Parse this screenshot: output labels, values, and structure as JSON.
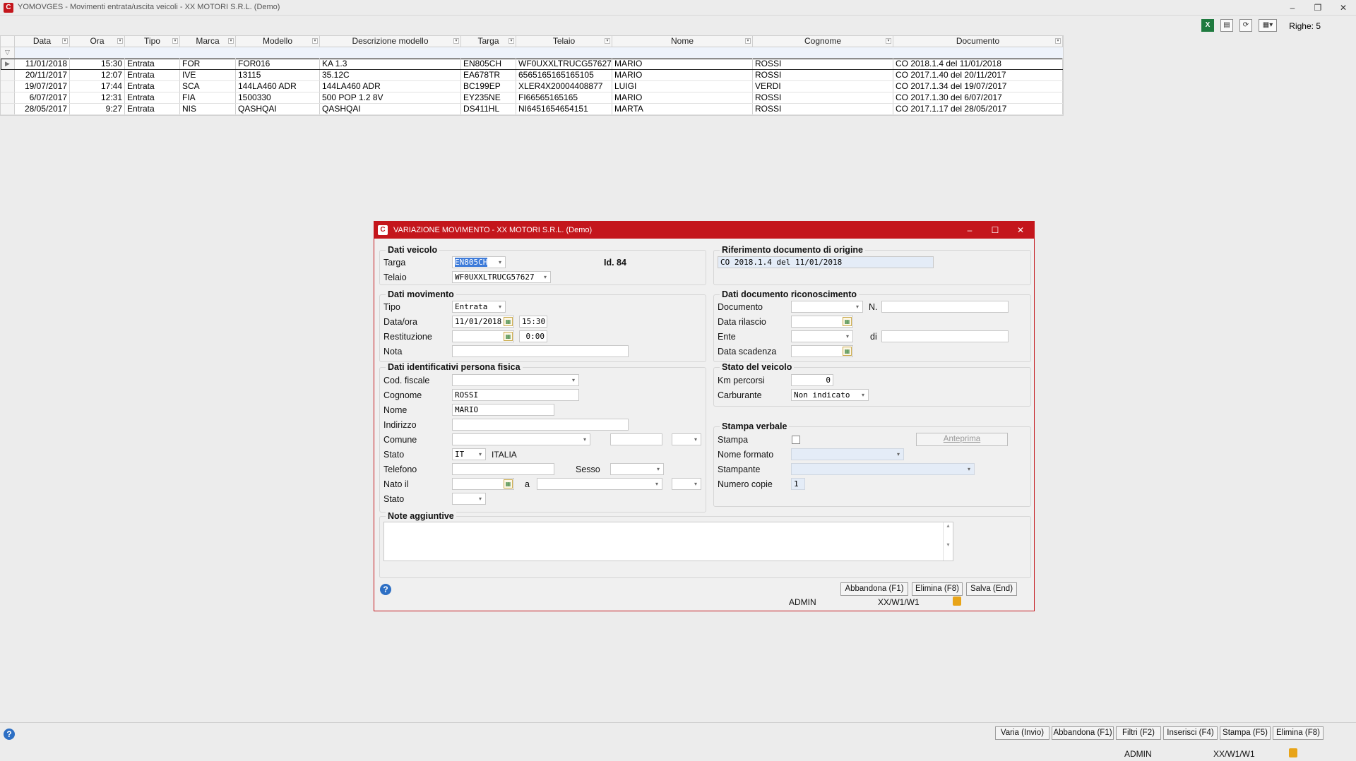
{
  "app": {
    "title": "YOMOVGES - Movimenti entrata/uscita veicoli - XX  MOTORI S.R.L.  (Demo)"
  },
  "toolbar": {
    "rows_label": "Righe: 5"
  },
  "grid": {
    "columns": [
      "Data",
      "Ora",
      "Tipo",
      "Marca",
      "Modello",
      "Descrizione modello",
      "Targa",
      "Telaio",
      "Nome",
      "Cognome",
      "Documento"
    ],
    "rows": [
      [
        "11/01/2018",
        "15:30",
        "Entrata",
        "FOR",
        "FOR016",
        "KA 1.3",
        "EN805CH",
        "WF0UXXLTRUCG57627",
        "MARIO",
        "ROSSI",
        "CO 2018.1.4 del 11/01/2018"
      ],
      [
        "20/11/2017",
        "12:07",
        "Entrata",
        "IVE",
        "13115",
        "35.12C",
        "EA678TR",
        "6565165165165105",
        "MARIO",
        "ROSSI",
        "CO 2017.1.40 del 20/11/2017"
      ],
      [
        "19/07/2017",
        "17:44",
        "Entrata",
        "SCA",
        "144LA460 ADR",
        "144LA460 ADR",
        "BC199EP",
        "XLER4X20004408877",
        "LUIGI",
        "VERDI",
        "CO 2017.1.34 del 19/07/2017"
      ],
      [
        "6/07/2017",
        "12:31",
        "Entrata",
        "FIA",
        "1500330",
        "500 POP 1.2 8V",
        "EY235NE",
        "FI66565165165",
        "MARIO",
        "ROSSI",
        "CO 2017.1.30 del 6/07/2017"
      ],
      [
        "28/05/2017",
        "9:27",
        "Entrata",
        "NIS",
        "QASHQAI",
        "QASHQAI",
        "DS411HL",
        "NI6451654654151",
        "MARTA",
        "ROSSI",
        "CO 2017.1.17 del 28/05/2017"
      ]
    ]
  },
  "dialog": {
    "title": "VARIAZIONE MOVIMENTO - XX  MOTORI S.R.L.  (Demo)",
    "dati_veicolo": {
      "title": "Dati veicolo",
      "targa_label": "Targa",
      "targa_value": "EN805CH",
      "telaio_label": "Telaio",
      "telaio_value": "WF0UXXLTRUCG57627",
      "id_label": "Id. 84"
    },
    "dati_movimento": {
      "title": "Dati movimento",
      "tipo_label": "Tipo",
      "tipo_value": "Entrata",
      "dataora_label": "Data/ora",
      "data_value": "11/01/2018",
      "ora_value": "15:30",
      "restituzione_label": "Restituzione",
      "restituzione_ora": "0:00",
      "nota_label": "Nota"
    },
    "dati_persona": {
      "title": "Dati identificativi persona fisica",
      "codfiscale_label": "Cod. fiscale",
      "cognome_label": "Cognome",
      "cognome_value": "ROSSI",
      "nome_label": "Nome",
      "nome_value": "MARIO",
      "indirizzo_label": "Indirizzo",
      "comune_label": "Comune",
      "stato_label": "Stato",
      "stato_code": "IT",
      "stato_name": "ITALIA",
      "telefono_label": "Telefono",
      "sesso_label": "Sesso",
      "natoil_label": "Nato il",
      "a_label": "a",
      "stato2_label": "Stato"
    },
    "riferimento": {
      "title": "Riferimento documento di origine",
      "value": "CO 2018.1.4 del 11/01/2018"
    },
    "documento_ric": {
      "title": "Dati documento riconoscimento",
      "documento_label": "Documento",
      "n_label": "N.",
      "data_rilascio_label": "Data rilascio",
      "ente_label": "Ente",
      "di_label": "di",
      "data_scadenza_label": "Data scadenza"
    },
    "stato_veicolo": {
      "title": "Stato del veicolo",
      "km_label": "Km percorsi",
      "km_value": "0",
      "carburante_label": "Carburante",
      "carburante_value": "Non indicato"
    },
    "stampa": {
      "title": "Stampa verbale",
      "stampa_label": "Stampa",
      "anteprima_label": "Anteprima",
      "nome_formato_label": "Nome formato",
      "stampante_label": "Stampante",
      "numero_copie_label": "Numero copie",
      "numero_copie_value": "1"
    },
    "note": {
      "title": "Note aggiuntive"
    },
    "buttons": {
      "abbandona": "Abbandona (F1)",
      "elimina": "Elimina (F8)",
      "salva": "Salva (End)"
    },
    "status": {
      "user": "ADMIN",
      "path": "XX/W1/W1"
    }
  },
  "bottom": {
    "buttons": [
      "Varia (Invio)",
      "Abbandona (F1)",
      "Filtri (F2)",
      "Inserisci (F4)",
      "Stampa (F5)",
      "Elimina (F8)"
    ],
    "user": "ADMIN",
    "path": "XX/W1/W1"
  }
}
